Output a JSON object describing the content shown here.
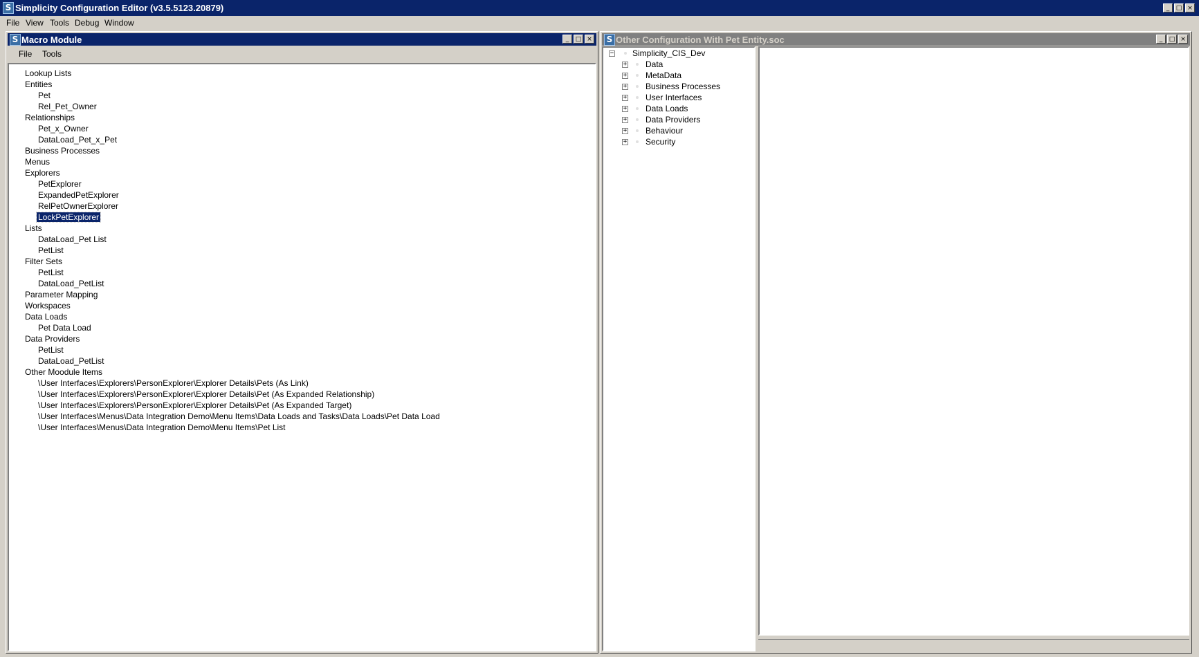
{
  "app": {
    "title": "Simplicity Configuration Editor (v3.5.5123.20879)",
    "icon_glyph": "S",
    "menu": [
      "File",
      "View",
      "Tools",
      "Debug",
      "Window"
    ]
  },
  "macro_window": {
    "title": "Macro Module",
    "menu": [
      "File",
      "Tools"
    ],
    "tree": [
      {
        "label": "Lookup Lists",
        "level": 0
      },
      {
        "label": "Entities",
        "level": 0
      },
      {
        "label": "Pet",
        "level": 1
      },
      {
        "label": "Rel_Pet_Owner",
        "level": 1
      },
      {
        "label": "Relationships",
        "level": 0
      },
      {
        "label": "Pet_x_Owner",
        "level": 1
      },
      {
        "label": "DataLoad_Pet_x_Pet",
        "level": 1
      },
      {
        "label": "Business Processes",
        "level": 0
      },
      {
        "label": "Menus",
        "level": 0
      },
      {
        "label": "Explorers",
        "level": 0
      },
      {
        "label": "PetExplorer",
        "level": 1
      },
      {
        "label": "ExpandedPetExplorer",
        "level": 1
      },
      {
        "label": "RelPetOwnerExplorer",
        "level": 1
      },
      {
        "label": "LockPetExplorer",
        "level": 1,
        "selected": true
      },
      {
        "label": "Lists",
        "level": 0
      },
      {
        "label": "DataLoad_Pet List",
        "level": 1
      },
      {
        "label": "PetList",
        "level": 1
      },
      {
        "label": "Filter Sets",
        "level": 0
      },
      {
        "label": "PetList",
        "level": 1
      },
      {
        "label": "DataLoad_PetList",
        "level": 1
      },
      {
        "label": "Parameter Mapping",
        "level": 0
      },
      {
        "label": "Workspaces",
        "level": 0
      },
      {
        "label": "Data Loads",
        "level": 0
      },
      {
        "label": "Pet Data Load",
        "level": 1
      },
      {
        "label": "Data Providers",
        "level": 0
      },
      {
        "label": "PetList",
        "level": 1
      },
      {
        "label": "DataLoad_PetList",
        "level": 1
      },
      {
        "label": "Other Moodule Items",
        "level": 0
      },
      {
        "label": "\\User Interfaces\\Explorers\\PersonExplorer\\Explorer Details\\Pets (As Link)",
        "level": 1
      },
      {
        "label": "\\User Interfaces\\Explorers\\PersonExplorer\\Explorer Details\\Pet (As Expanded Relationship)",
        "level": 1
      },
      {
        "label": "\\User Interfaces\\Explorers\\PersonExplorer\\Explorer Details\\Pet (As Expanded Target)",
        "level": 1
      },
      {
        "label": "\\User Interfaces\\Menus\\Data Integration Demo\\Menu Items\\Data Loads and Tasks\\Data Loads\\Pet Data Load",
        "level": 1
      },
      {
        "label": "\\User Interfaces\\Menus\\Data Integration Demo\\Menu Items\\Pet List",
        "level": 1
      }
    ]
  },
  "config_window": {
    "title": "Other Configuration With Pet Entity.soc",
    "root": {
      "label": "Simplicity_CIS_Dev",
      "expander": "−"
    },
    "children": [
      {
        "label": "Data",
        "expander": "+"
      },
      {
        "label": "MetaData",
        "expander": "+"
      },
      {
        "label": "Business Processes",
        "expander": "+"
      },
      {
        "label": "User Interfaces",
        "expander": "+"
      },
      {
        "label": "Data Loads",
        "expander": "+"
      },
      {
        "label": "Data Providers",
        "expander": "+"
      },
      {
        "label": "Behaviour",
        "expander": "+"
      },
      {
        "label": "Security",
        "expander": "+"
      }
    ]
  },
  "window_buttons": {
    "minimize": "_",
    "maximize": "□",
    "close": "×"
  }
}
